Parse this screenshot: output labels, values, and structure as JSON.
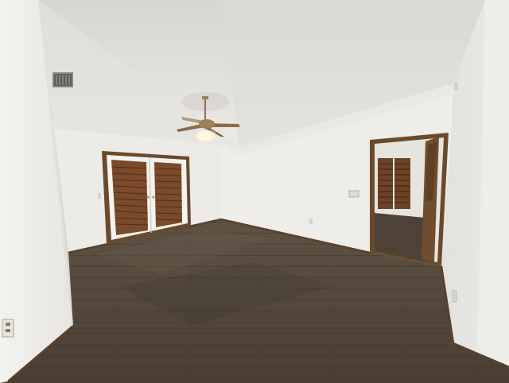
{
  "scene": {
    "subject": "empty room",
    "objects": [
      {
        "name": "textured-ceiling"
      },
      {
        "name": "ceiling-fan"
      },
      {
        "name": "hvac-vent"
      },
      {
        "name": "french-doors-with-shutters"
      },
      {
        "name": "open-doorway"
      },
      {
        "name": "hardwood-floor"
      },
      {
        "name": "electrical-outlet"
      },
      {
        "name": "light-switch"
      }
    ],
    "colors": {
      "ceiling": "#e6e4e0",
      "wall_left": "#e9e8e4",
      "wall_back": "#eeede9",
      "wall_right": "#e3e2de",
      "floor": "#56493d",
      "floor_dark": "#3f352c",
      "trim": "#6a4a2c",
      "shutter": "#7b4a2a",
      "fan_metal": "#9b8258"
    }
  }
}
